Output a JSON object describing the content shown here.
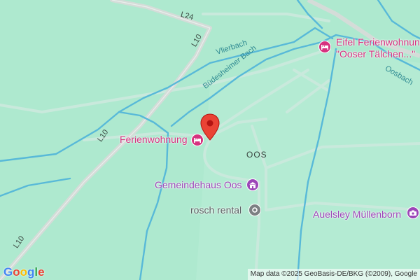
{
  "map": {
    "roads": {
      "l24": "L24",
      "l10_top": "L10",
      "l10_mid": "L10",
      "l10_bottom": "L10"
    },
    "waterways": {
      "vlierbach": "Vlierbach",
      "budesheimer_bach": "Büdesheimer Bach",
      "oosbach": "Oosbach"
    },
    "locality": "OOS",
    "pois": {
      "eifel_line1": "Eifel Ferienwohnung",
      "eifel_line2": "\"Ooser Tälchen...\"",
      "ferienwohnung": "Ferienwohnung",
      "gemeindehaus": "Gemeindehaus Oos",
      "rosch": "rosch rental",
      "auelsley": "Auelsley Müllenborn"
    },
    "icons": {
      "lodging": "hotel-bed-icon",
      "community": "building-icon",
      "rental": "circle-dot-icon",
      "camera": "camera-icon",
      "pin": "location-pin-icon"
    },
    "colors": {
      "land": "#aee9cf",
      "water": "#58b9d8",
      "road": "#cdd9d3",
      "lodging": "#d6327f",
      "civic": "#9c46b8",
      "pin": "#ea4335"
    },
    "logo": "Google",
    "attribution": "Map data ©2025 GeoBasis-DE/BKG (©2009), Google"
  }
}
